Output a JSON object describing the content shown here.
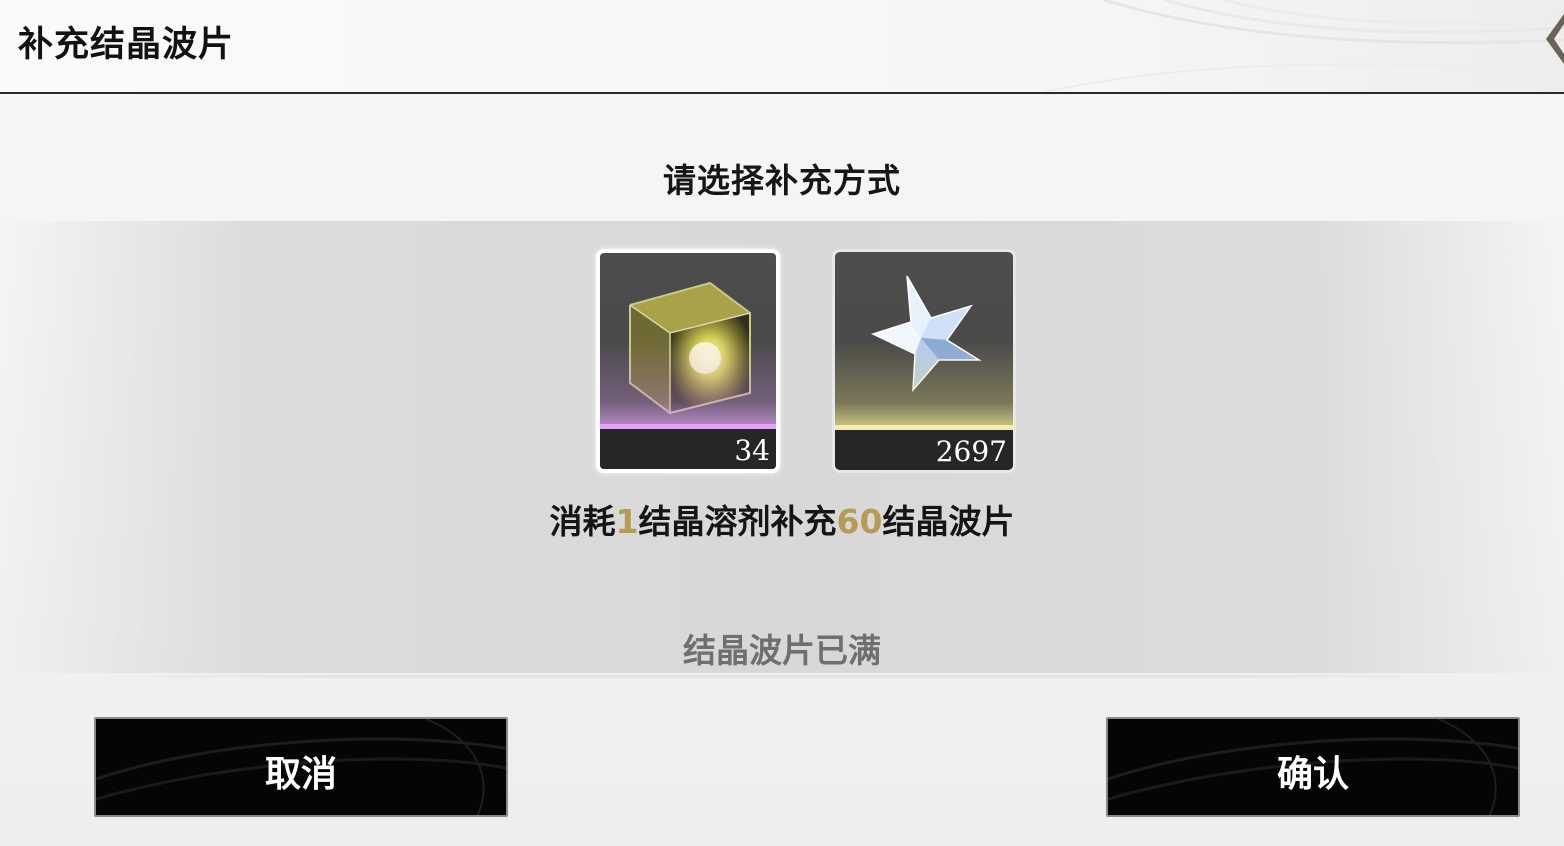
{
  "header": {
    "title": "补充结晶波片"
  },
  "dialog": {
    "prompt": "请选择补充方式",
    "options": [
      {
        "count": "34",
        "icon": "crystal-solvent-cube-icon",
        "selected": true
      },
      {
        "count": "2697",
        "icon": "star-crystal-icon",
        "selected": false
      }
    ],
    "description": {
      "part1": "消耗",
      "cost": "1",
      "part2": "结晶溶剂补充",
      "amount": "60",
      "part3": "结晶波片"
    },
    "status": "结晶波片已满"
  },
  "buttons": {
    "cancel_label": "取消",
    "confirm_label": "确认"
  },
  "colors": {
    "highlight": "#b79a55",
    "button_bg": "#050505",
    "rarity_purple": "#e4a3f3",
    "rarity_gold": "#f4eea6"
  }
}
